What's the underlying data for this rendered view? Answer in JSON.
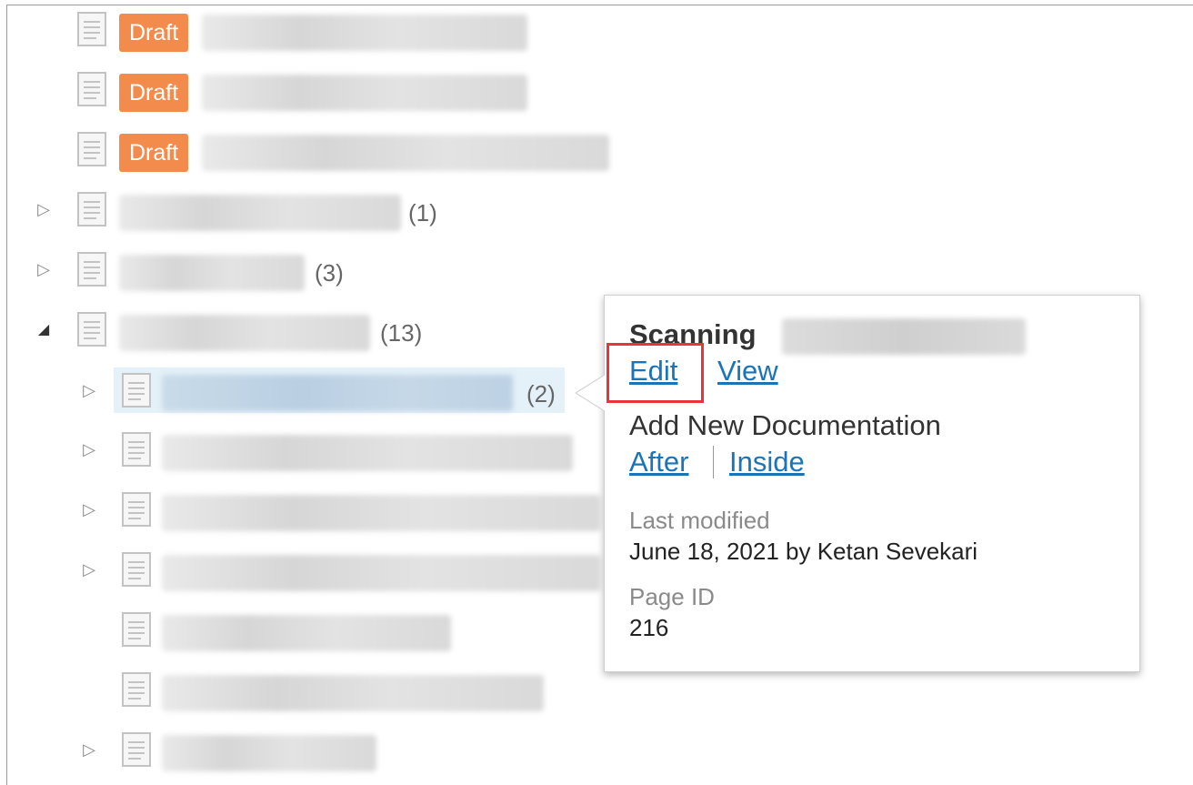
{
  "tree": {
    "draft_label": "Draft",
    "rows": [
      {
        "id": "r1",
        "count": ""
      },
      {
        "id": "r2",
        "count": ""
      },
      {
        "id": "r3",
        "count": ""
      },
      {
        "id": "r4",
        "count": "(1)"
      },
      {
        "id": "r5",
        "count": "(3)"
      },
      {
        "id": "r6",
        "count": "(13)"
      },
      {
        "id": "r7",
        "count": "(2)"
      }
    ]
  },
  "popup": {
    "title_prefix": "Scanning",
    "edit_label": "Edit",
    "view_label": "View",
    "add_new_label": "Add New Documentation",
    "after_label": "After",
    "inside_label": "Inside",
    "last_modified_label": "Last modified",
    "last_modified_value": "June 18, 2021 by Ketan Sevekari",
    "page_id_label": "Page ID",
    "page_id_value": "216"
  },
  "colors": {
    "draft_badge": "#f28b4b",
    "link": "#1a74b8",
    "highlight_box": "#e8343a",
    "selected_row": "#e5f1f9"
  }
}
